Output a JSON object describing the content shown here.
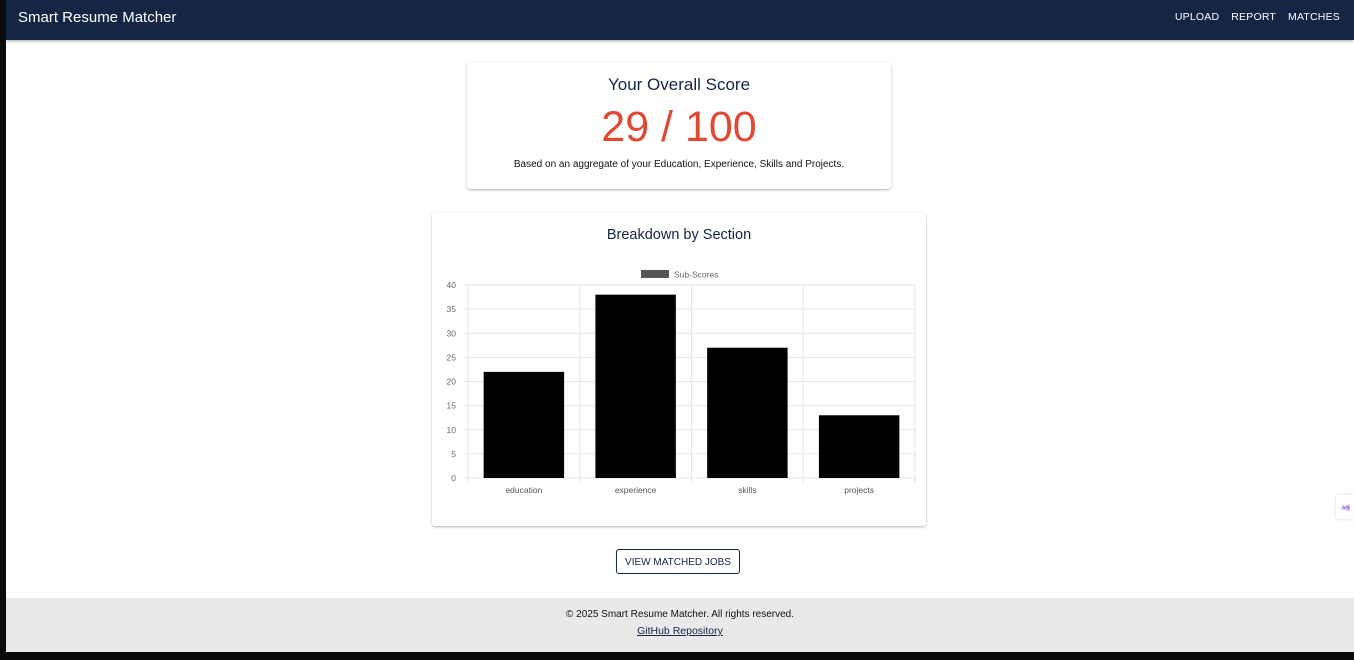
{
  "appbar": {
    "title": "Smart Resume Matcher",
    "nav": [
      "UPLOAD",
      "REPORT",
      "MATCHES"
    ]
  },
  "score": {
    "title": "Your Overall Score",
    "value": "29 / 100",
    "note": "Based on an aggregate of your Education, Experience, Skills and Projects."
  },
  "breakdown": {
    "title": "Breakdown by Section"
  },
  "chart_data": {
    "type": "bar",
    "categories": [
      "education",
      "experience",
      "skills",
      "projects"
    ],
    "series": [
      {
        "name": "Sub-Scores",
        "values": [
          22,
          38,
          27,
          13
        ]
      }
    ],
    "ylim": [
      0,
      40
    ],
    "yticks": [
      0,
      5,
      10,
      15,
      20,
      25,
      30,
      35,
      40
    ],
    "grid": true,
    "legend": "top-center",
    "bar_color": "#000000",
    "legend_color": "#555555"
  },
  "actions": {
    "view_matched_jobs": "VIEW MATCHED JOBS"
  },
  "footer": {
    "copyright": "© 2025 Smart Resume Matcher. All rights reserved.",
    "link": "GitHub Repository"
  },
  "colors": {
    "primary": "#152544",
    "score": "#e04a33",
    "footer_bg": "#e9e9e9"
  }
}
